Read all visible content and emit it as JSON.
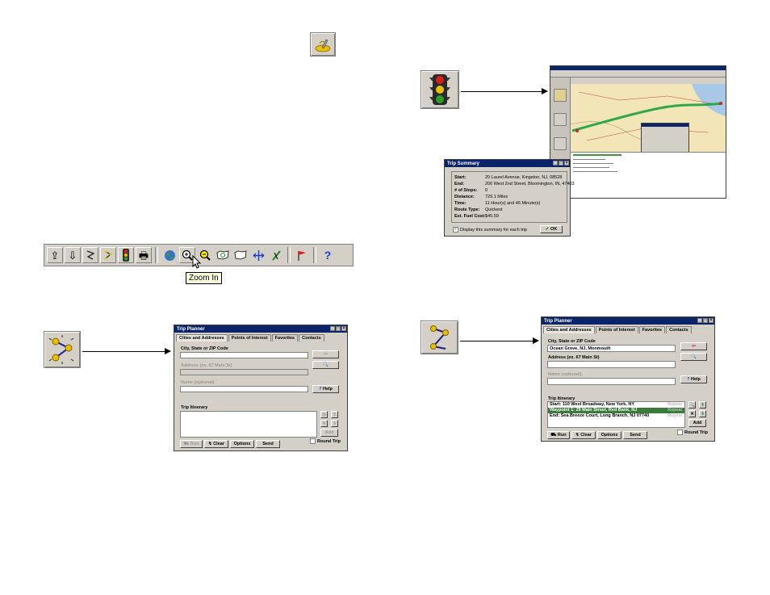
{
  "toolbar": {
    "buttons": [
      "export-icon",
      "import-icon",
      "route-icon",
      "calculate-route-icon",
      "traffic-light-icon",
      "print-icon",
      "globe-icon",
      "zoom-in-icon",
      "zoom-out-icon",
      "zoom-region-icon",
      "usa-map-icon",
      "pan-icon",
      "draw-icon",
      "flag-icon",
      "help-icon"
    ],
    "tooltip": "Zoom In"
  },
  "trip_planner_empty": {
    "title": "Trip Planner",
    "tabs": [
      "Cities and Addresses",
      "Points of Interest",
      "Favorites",
      "Contacts"
    ],
    "city_label": "City, State or ZIP Code",
    "city_value": "",
    "address_label": "Address (ex. 67 Main St)",
    "address_value": "",
    "name_label": "Name (optional)",
    "name_value": "",
    "help_label": "Help",
    "itinerary_label": "Trip Itinerary",
    "add_label": "Add",
    "round_trip_label": "Round Trip",
    "run_label": "Run",
    "clear_label": "Clear",
    "options_label": "Options",
    "send_label": "Send"
  },
  "trip_planner_filled": {
    "title": "Trip Planner",
    "tabs": [
      "Cities and Addresses",
      "Points of Interest",
      "Favorites",
      "Contacts"
    ],
    "city_label": "City, State or ZIP Code",
    "city_value": "Ocean Grove, NJ, Monmouth",
    "address_label": "Address (ex. 67 Main St)",
    "address_value": "",
    "name_label": "Name (optional)",
    "name_value": "",
    "help_label": "Help",
    "itinerary_label": "Trip Itinerary",
    "itinerary": [
      {
        "text": "Start: 110 West Broadway, New York, NY",
        "status": "Repeat",
        "selected": false
      },
      {
        "text": "Waypoint 1: 29 Main Street, Red Bank, NJ",
        "status": "Repeat",
        "selected": true
      },
      {
        "text": "End: Sea Breeze Court, Long Branch, NJ 07740",
        "status": "Repeat",
        "selected": false
      }
    ],
    "add_label": "Add",
    "round_trip_label": "Round Trip",
    "run_label": "Run",
    "clear_label": "Clear",
    "options_label": "Options",
    "send_label": "Send"
  },
  "trip_summary": {
    "title": "Trip Summary",
    "rows": [
      {
        "label": "Start:",
        "value": "20 Laurel Avenue, Kingston, NJ, 08528"
      },
      {
        "label": "End:",
        "value": "206 West 2nd Street, Bloomington, IN, 47403"
      },
      {
        "label": "# of Stops:",
        "value": "0"
      },
      {
        "label": "Distance:",
        "value": "729.1 Miles"
      },
      {
        "label": "Time:",
        "value": "11 Hour(s) and 46 Minute(s)"
      },
      {
        "label": "Route Type:",
        "value": "Quickest"
      },
      {
        "label": "Est. Fuel Cost:",
        "value": "$45.59"
      }
    ],
    "display_label": "Display this summary for each trip",
    "ok_label": "OK"
  },
  "colors": {
    "win_title": "#0a246a",
    "selection": "#3a7a3a",
    "route": "#2ea84a",
    "map_land": "#f2e6b8",
    "map_water": "#a9c8e8"
  }
}
